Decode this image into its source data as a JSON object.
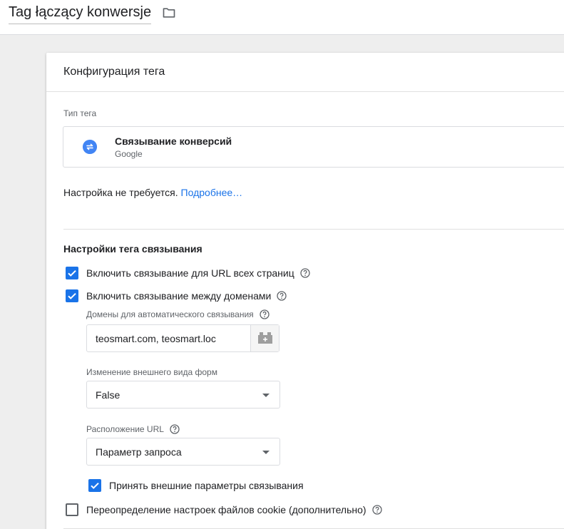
{
  "header": {
    "title": "Tag łączący konwersje",
    "folder_icon": "folder-icon"
  },
  "config": {
    "title": "Конфигурация тега",
    "type_label": "Тип тега",
    "tag_type": {
      "name": "Связывание конверсий",
      "vendor": "Google",
      "icon": "link-swap-icon",
      "icon_color": "#4285f4"
    },
    "no_setup_text": "Настройка не требуется.",
    "learn_more": "Подробнее…"
  },
  "linker": {
    "title": "Настройки тега связывания",
    "options": [
      {
        "label": "Включить связывание для URL всех страниц",
        "checked": true
      },
      {
        "label": "Включить связывание между доменами",
        "checked": true
      },
      {
        "label": "Принять внешние параметры связывания",
        "checked": true
      },
      {
        "label": "Переопределение настроек файлов cookie (дополнительно)",
        "checked": false
      }
    ],
    "domains_label": "Домены для автоматического связывания",
    "domains_value": "teosmart.com, teosmart.loc",
    "form_label": "Изменение внешнего вида форм",
    "form_value": "False",
    "url_label": "Расположение URL",
    "url_value": "Параметр запроса"
  },
  "colors": {
    "accent": "#1a73e8",
    "checkbox_on": "#1a73e8",
    "border": "#dadce0"
  }
}
